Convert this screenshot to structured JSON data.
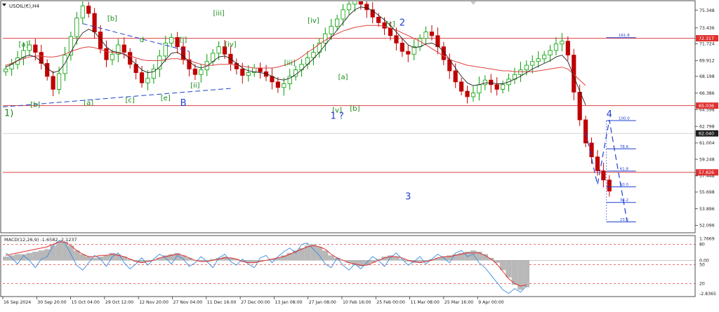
{
  "window": {
    "symbol_label": "USOIL(€),H4"
  },
  "colors": {
    "background": "#ffffff",
    "candle_up": "#00a000",
    "candle_down": "#c00000",
    "ma_slow": "#e04040",
    "ma_fast": "#202020",
    "hline": "#e04040",
    "wave_green": "#1a8c1a",
    "wave_blue": "#1f3fd0",
    "macd_hist": "#b8b8b8",
    "macd_line": "#3a8fe0",
    "macd_signal": "#e03030",
    "fib": "#1f3fd0",
    "price_tag_red": "#e03030",
    "price_tag_black": "#202020"
  },
  "chart_data": {
    "type": "line",
    "price_axis": {
      "range": [
        51.3,
        76.3
      ],
      "ticks": [
        "75.348",
        "73.436",
        "71.724",
        "69.912",
        "68.198",
        "66.386",
        "64.598",
        "62.798",
        "61.004",
        "59.248",
        "57.448",
        "55.698",
        "53.896",
        "52.096"
      ]
    },
    "time_axis": {
      "labels": [
        "16 Sep 2024",
        "30 Sep 20:00",
        "15 Oct 04:00",
        "29 Oct 12:00",
        "12 Nov 20:00",
        "27 Nov 04:00",
        "11 Dec 16:00",
        "27 Dec 00:00",
        "13 Jan 08:00",
        "27 Jan 08:00",
        "10 Feb 16:00",
        "25 Feb 00:00",
        "11 Mar 08:00",
        "25 Mar 16:00",
        "9 Apr 00:00"
      ]
    },
    "price_tags": [
      {
        "text": "72.317",
        "value": 72.317,
        "style": "red"
      },
      {
        "text": "65.036",
        "value": 65.036,
        "style": "red"
      },
      {
        "text": "62.040",
        "value": 62.04,
        "style": "black"
      },
      {
        "text": "57.826",
        "value": 57.826,
        "style": "red"
      }
    ],
    "horizontal_lines": [
      72.317,
      65.036,
      57.826
    ],
    "price_series": {
      "name": "USOIL H4 close",
      "values": [
        69.0,
        69.5,
        70.2,
        71.0,
        71.6,
        70.8,
        69.6,
        68.2,
        66.8,
        68.5,
        70.5,
        72.5,
        74.5,
        75.8,
        75.0,
        73.0,
        71.2,
        70.0,
        70.6,
        71.6,
        70.8,
        69.5,
        68.6,
        67.5,
        68.0,
        69.0,
        70.4,
        71.8,
        72.4,
        71.4,
        70.0,
        69.0,
        68.4,
        68.9,
        69.8,
        70.7,
        71.4,
        70.6,
        69.6,
        69.0,
        68.3,
        68.6,
        69.1,
        68.7,
        68.2,
        67.6,
        67.0,
        67.4,
        68.2,
        68.9,
        69.5,
        70.2,
        70.8,
        71.8,
        72.8,
        73.6,
        74.4,
        75.4,
        76.0,
        76.5,
        76.0,
        75.4,
        74.6,
        74.0,
        73.4,
        72.6,
        71.8,
        70.9,
        70.6,
        71.4,
        72.3,
        73.0,
        72.6,
        71.4,
        70.0,
        68.8,
        67.6,
        66.6,
        66.0,
        66.4,
        67.3,
        67.8,
        67.3,
        66.8,
        67.3,
        67.9,
        68.4,
        68.9,
        69.4,
        69.8,
        70.1,
        70.5,
        71.0,
        71.7,
        72.0,
        70.5,
        66.5,
        63.5,
        61.0,
        59.5,
        58.0,
        57.0,
        55.8
      ]
    },
    "ma_slow": {
      "values": [
        69.4,
        69.6,
        69.9,
        70.1,
        70.3,
        70.4,
        70.4,
        70.3,
        70.3,
        70.4,
        70.6,
        70.9,
        71.1,
        71.3,
        71.4,
        71.3,
        71.1,
        70.9,
        70.8,
        70.7,
        70.6,
        70.4,
        70.2,
        70.0,
        69.9,
        69.9,
        69.9,
        70.0,
        70.1,
        70.1,
        70.0,
        69.9,
        69.7,
        69.5,
        69.4,
        69.4,
        69.5,
        69.5,
        69.5,
        69.4,
        69.3,
        69.2,
        69.1,
        69.1,
        69.1,
        69.1,
        69.2,
        69.4,
        69.6,
        69.9,
        70.3,
        70.8,
        71.2,
        71.7,
        72.1,
        72.5,
        72.8,
        73.1,
        73.3,
        73.5,
        73.6,
        73.7,
        73.7,
        73.7,
        73.6,
        73.4,
        73.2,
        72.9,
        72.6,
        72.3,
        72.0,
        71.6,
        71.2,
        70.8,
        70.4,
        70.0,
        69.8,
        69.6,
        69.4,
        69.3,
        69.2,
        69.1,
        69.0,
        68.9,
        68.8,
        68.8,
        68.7,
        68.7,
        68.7,
        68.7,
        68.8,
        68.9,
        69.0,
        69.1,
        69.2,
        69.0,
        68.4,
        67.8,
        67.2
      ]
    },
    "ma_fast": {
      "values": [
        69.2,
        69.5,
        69.9,
        70.3,
        70.5,
        70.3,
        69.8,
        69.1,
        68.6,
        68.8,
        69.6,
        70.8,
        72.0,
        72.9,
        73.3,
        73.0,
        72.2,
        71.4,
        70.9,
        70.8,
        70.6,
        70.1,
        69.5,
        68.9,
        68.6,
        68.7,
        69.2,
        70.0,
        70.7,
        70.8,
        70.4,
        69.8,
        69.3,
        69.1,
        69.3,
        69.8,
        70.3,
        70.4,
        70.1,
        69.6,
        69.1,
        68.8,
        68.7,
        68.6,
        68.5,
        68.2,
        67.9,
        67.8,
        68.0,
        68.4,
        68.9,
        69.5,
        70.1,
        70.8,
        71.6,
        72.4,
        73.2,
        74.0,
        74.8,
        75.4,
        75.7,
        75.6,
        75.3,
        74.8,
        74.3,
        73.7,
        73.0,
        72.3,
        71.6,
        71.3,
        71.4,
        71.7,
        71.8,
        71.5,
        70.9,
        70.0,
        69.1,
        68.2,
        67.5,
        67.2,
        67.3,
        67.5,
        67.5,
        67.4,
        67.4,
        67.6,
        67.9,
        68.2,
        68.6,
        69.0,
        69.3,
        69.6,
        69.9,
        70.3,
        70.5,
        69.8,
        68.2,
        66.6,
        65.1
      ]
    },
    "projection": {
      "points": [
        [
          98,
          62.2
        ],
        [
          100,
          56.5
        ],
        [
          102,
          63.5
        ],
        [
          105,
          52.5
        ]
      ],
      "labels": [
        "4"
      ]
    },
    "fibonacci": {
      "labels": [
        "161.8",
        "100.0",
        "78.6",
        "61.8",
        "50.0",
        "38.2",
        "23.6"
      ],
      "values": [
        72.38,
        63.42,
        60.37,
        57.97,
        56.26,
        54.58,
        52.47
      ]
    },
    "wave_labels_green": [
      "[a]",
      "[b]",
      "[b]",
      "[a]",
      "d",
      "[c]",
      "[e]",
      "[i]",
      "[ii]",
      "[iii]",
      "[iv]",
      "[iii]",
      "[iv]",
      "[v]",
      "[a]",
      "[b]",
      "[c]"
    ],
    "wave_labels_blue": [
      "B",
      "1 ?",
      "2",
      "3",
      "4"
    ],
    "wave_labels_black": [
      "1)"
    ],
    "macd": {
      "label": "MACD(12,26,9) -1.6582 -2.1237",
      "range": [
        -2.9,
        1.9
      ],
      "ticks": [
        "1.7669",
        "80",
        "0.00",
        "50",
        "20",
        "-2.8365"
      ],
      "levels": [
        80,
        50,
        20
      ],
      "hist": [
        0.3,
        0.4,
        0.5,
        0.5,
        0.6,
        0.7,
        0.8,
        0.9,
        1.2,
        1.5,
        1.5,
        1.2,
        0.8,
        0.5,
        0.3,
        0.2,
        0.3,
        0.4,
        0.6,
        0.5,
        0.3,
        0.1,
        -0.1,
        -0.2,
        -0.1,
        0.0,
        0.2,
        0.4,
        0.5,
        0.6,
        0.4,
        0.2,
        0.0,
        -0.1,
        -0.1,
        0.1,
        0.2,
        0.3,
        0.2,
        0.1,
        -0.1,
        -0.2,
        -0.2,
        -0.1,
        0.0,
        0.1,
        0.2,
        0.4,
        0.6,
        0.8,
        1.0,
        1.2,
        1.3,
        1.1,
        0.8,
        0.4,
        0.2,
        0.0,
        -0.2,
        -0.4,
        -0.5,
        -0.4,
        -0.2,
        0.1,
        0.3,
        0.4,
        0.3,
        0.1,
        -0.1,
        -0.2,
        -0.2,
        -0.1,
        0.1,
        0.2,
        0.3,
        0.4,
        0.5,
        0.6,
        0.7,
        0.8,
        0.7,
        0.5,
        0.2,
        -0.2,
        -0.8,
        -1.4,
        -2.0,
        -2.4,
        -2.2
      ],
      "signal": [
        0.4,
        0.5,
        0.6,
        0.7,
        0.8,
        0.9,
        1.0,
        1.1,
        1.3,
        1.5,
        1.5,
        1.2,
        0.8,
        0.5,
        0.3,
        0.3,
        0.4,
        0.4,
        0.5,
        0.4,
        0.3,
        0.1,
        -0.1,
        -0.2,
        -0.1,
        0.0,
        0.2,
        0.3,
        0.4,
        0.5,
        0.4,
        0.2,
        0.0,
        -0.1,
        -0.1,
        0.0,
        0.1,
        0.2,
        0.2,
        0.1,
        -0.1,
        -0.2,
        -0.2,
        -0.1,
        0.0,
        0.1,
        0.2,
        0.3,
        0.5,
        0.7,
        0.9,
        1.1,
        1.2,
        1.1,
        0.9,
        0.5,
        0.2,
        0.0,
        -0.2,
        -0.3,
        -0.4,
        -0.4,
        -0.2,
        0.0,
        0.2,
        0.3,
        0.3,
        0.2,
        0.0,
        -0.1,
        -0.2,
        -0.1,
        0.0,
        0.2,
        0.3,
        0.3,
        0.4,
        0.5,
        0.6,
        0.6,
        0.6,
        0.4,
        0.1,
        -0.3,
        -0.9,
        -1.5,
        -1.9,
        -2.1,
        -2.0
      ],
      "osc": [
        0.6,
        0.2,
        -0.3,
        0.4,
        0.0,
        -0.6,
        0.1,
        0.3,
        1.2,
        1.6,
        1.4,
        0.5,
        -0.4,
        -0.8,
        -0.2,
        0.4,
        0.1,
        -0.5,
        0.3,
        0.6,
        -0.2,
        -0.7,
        -0.3,
        0.2,
        -0.4,
        0.1,
        0.5,
        0.2,
        -0.3,
        0.4,
        0.1,
        -0.5,
        -0.2,
        0.3,
        -0.1,
        -0.6,
        0.2,
        0.5,
        -0.1,
        -0.4,
        0.1,
        -0.3,
        -0.6,
        0.2,
        0.4,
        -0.2,
        0.3,
        0.7,
        1.0,
        0.6,
        1.3,
        1.4,
        0.9,
        0.4,
        -0.3,
        -0.6,
        0.2,
        -0.4,
        -0.8,
        -0.3,
        -0.7,
        -0.2,
        0.3,
        0.0,
        -0.5,
        0.2,
        0.6,
        0.1,
        -0.4,
        -0.1,
        0.3,
        -0.3,
        0.1,
        0.5,
        0.2,
        -0.2,
        0.6,
        0.8,
        0.3,
        0.5,
        -0.2,
        -0.6,
        -1.2,
        -1.8,
        -2.4,
        -2.7,
        -2.3,
        -2.6,
        -2.1
      ]
    }
  }
}
